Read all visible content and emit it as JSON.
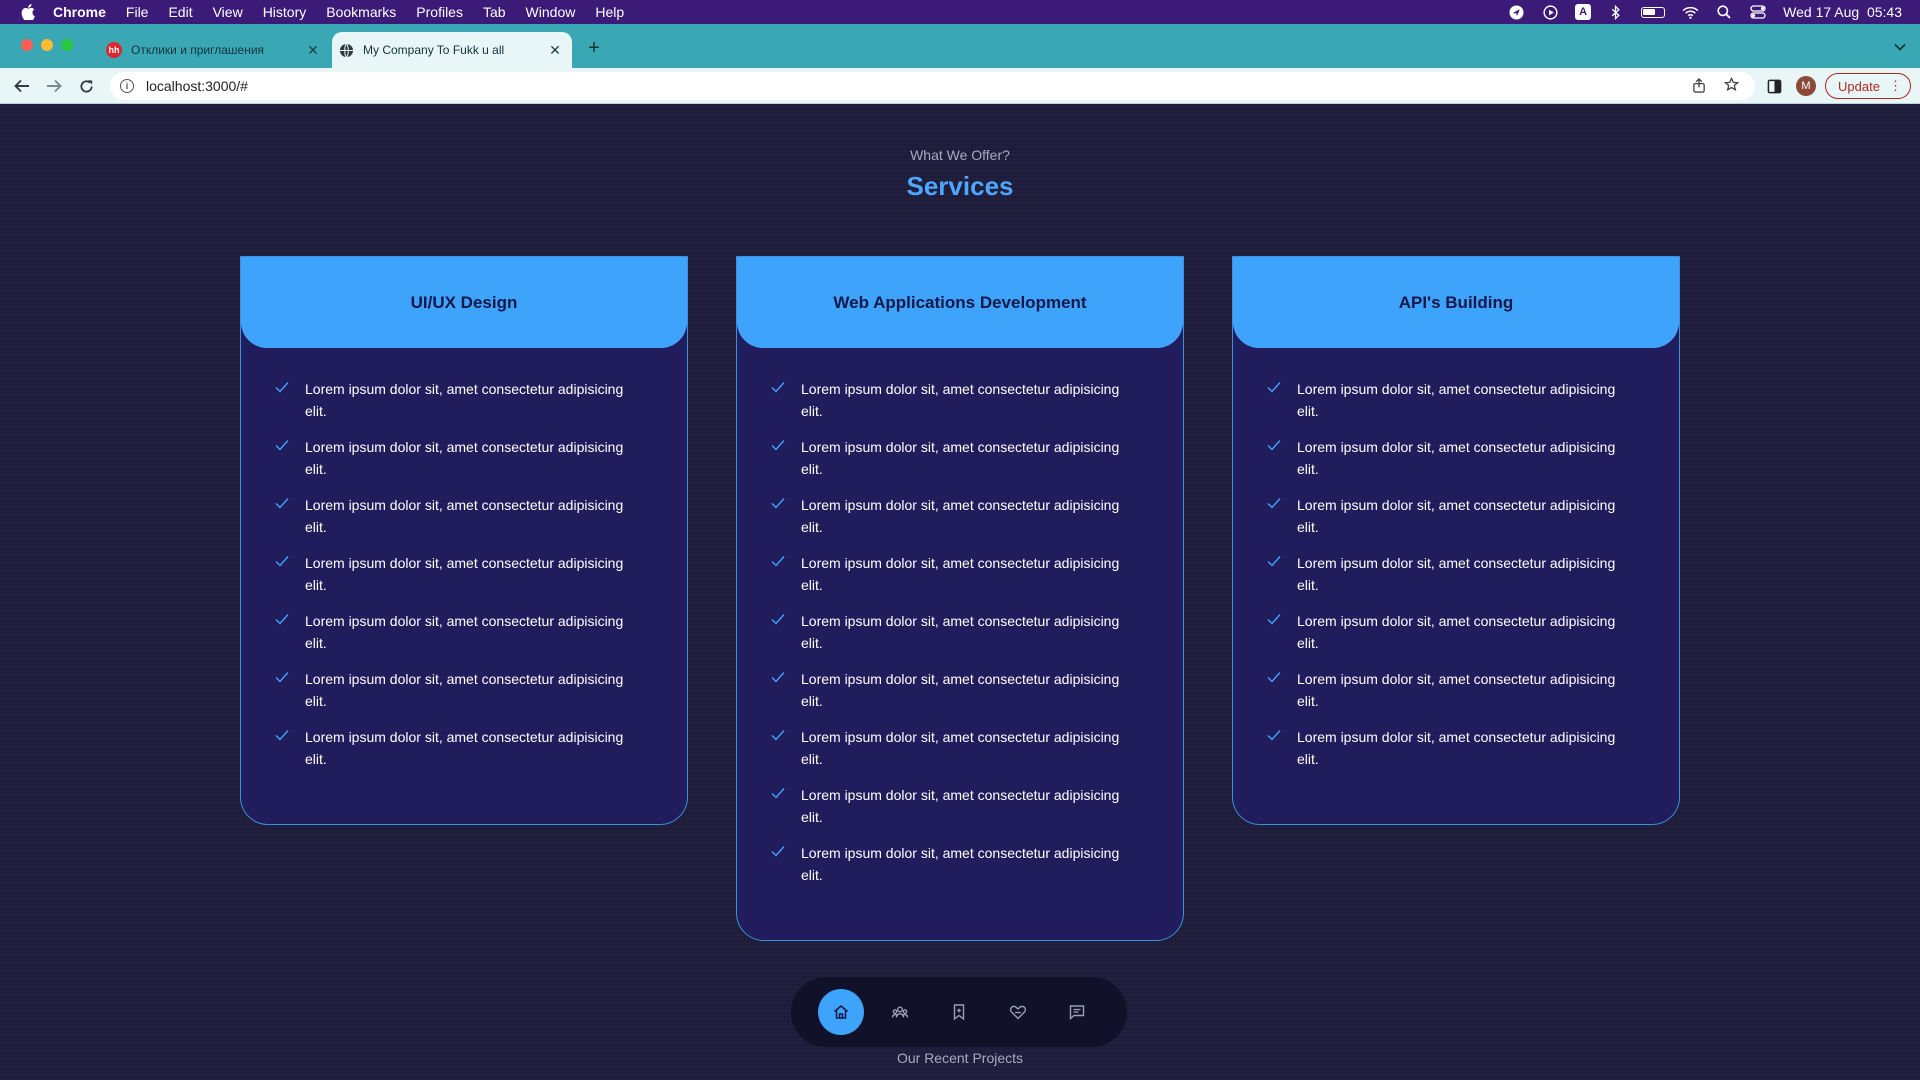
{
  "menubar": {
    "app_name": "Chrome",
    "items": [
      "File",
      "Edit",
      "View",
      "History",
      "Bookmarks",
      "Profiles",
      "Tab",
      "Window",
      "Help"
    ],
    "input_badge": "A",
    "datetime": "Wed 17 Aug  05:43"
  },
  "browser": {
    "tabs": [
      {
        "title": "Отклики и приглашения",
        "favicon_text": "hh"
      },
      {
        "title": "My Company To Fukk u all"
      }
    ],
    "url": "localhost:3000/#",
    "avatar_letter": "M",
    "update_label": "Update"
  },
  "page": {
    "subtitle": "What We Offer?",
    "title": "Services",
    "cards": [
      {
        "title": "UI/UX Design",
        "items": [
          "Lorem ipsum dolor sit, amet consectetur adipisicing elit.",
          "Lorem ipsum dolor sit, amet consectetur adipisicing elit.",
          "Lorem ipsum dolor sit, amet consectetur adipisicing elit.",
          "Lorem ipsum dolor sit, amet consectetur adipisicing elit.",
          "Lorem ipsum dolor sit, amet consectetur adipisicing elit.",
          "Lorem ipsum dolor sit, amet consectetur adipisicing elit.",
          "Lorem ipsum dolor sit, amet consectetur adipisicing elit."
        ]
      },
      {
        "title": "Web Applications Development",
        "items": [
          "Lorem ipsum dolor sit, amet consectetur adipisicing elit.",
          "Lorem ipsum dolor sit, amet consectetur adipisicing elit.",
          "Lorem ipsum dolor sit, amet consectetur adipisicing elit.",
          "Lorem ipsum dolor sit, amet consectetur adipisicing elit.",
          "Lorem ipsum dolor sit, amet consectetur adipisicing elit.",
          "Lorem ipsum dolor sit, amet consectetur adipisicing elit.",
          "Lorem ipsum dolor sit, amet consectetur adipisicing elit.",
          "Lorem ipsum dolor sit, amet consectetur adipisicing elit.",
          "Lorem ipsum dolor sit, amet consectetur adipisicing elit."
        ]
      },
      {
        "title": "API's Building",
        "items": [
          "Lorem ipsum dolor sit, amet consectetur adipisicing elit.",
          "Lorem ipsum dolor sit, amet consectetur adipisicing elit.",
          "Lorem ipsum dolor sit, amet consectetur adipisicing elit.",
          "Lorem ipsum dolor sit, amet consectetur adipisicing elit.",
          "Lorem ipsum dolor sit, amet consectetur adipisicing elit.",
          "Lorem ipsum dolor sit, amet consectetur adipisicing elit.",
          "Lorem ipsum dolor sit, amet consectetur adipisicing elit."
        ]
      }
    ],
    "bottom_nav": [
      "home-icon",
      "team-icon",
      "bookmark-icon",
      "services-icon",
      "message-icon"
    ],
    "next_section": "Our Recent Projects"
  },
  "colors": {
    "accent": "#3ea3fb",
    "card_bg": "#211d5c",
    "page_bg": "#1d1c3a",
    "title": "#4da6ff"
  }
}
